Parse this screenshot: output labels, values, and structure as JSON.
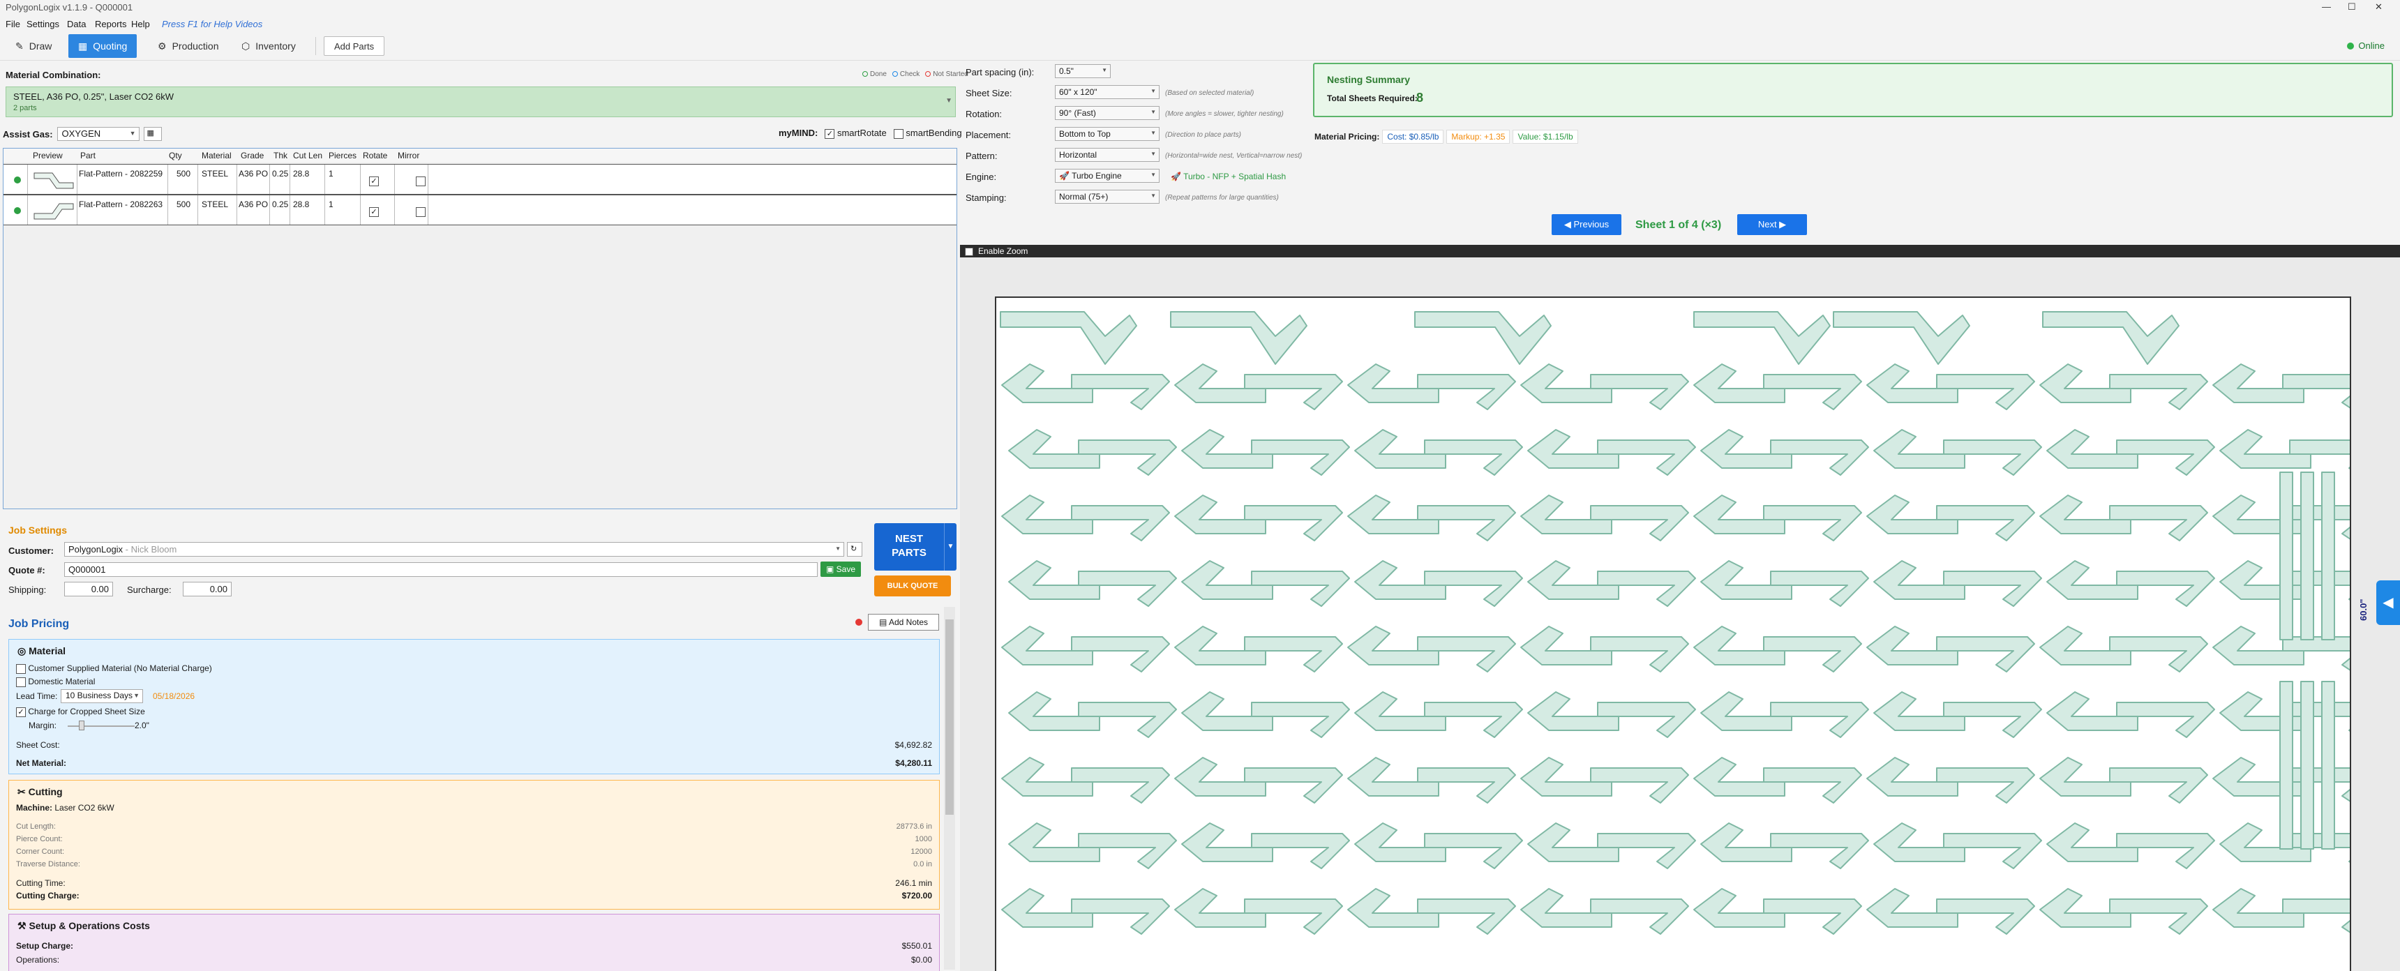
{
  "window": {
    "title": "PolygonLogix v1.1.9 - Q000001",
    "min": "—",
    "max": "☐",
    "close": "✕"
  },
  "menu": {
    "file": "File",
    "settings": "Settings",
    "data": "Data",
    "reports": "Reports",
    "help": "Help",
    "hint": "Press F1 for Help Videos"
  },
  "tabs": {
    "draw": "Draw",
    "quoting": "Quoting",
    "production": "Production",
    "inventory": "Inventory",
    "add_parts": "Add Parts"
  },
  "status": {
    "online": "Online"
  },
  "material": {
    "label": "Material Combination:",
    "legend": {
      "done": "Done",
      "check": "Check",
      "not_started": "Not Started"
    },
    "combo_title": "STEEL, A36 PO, 0.25\", Laser CO2 6kW",
    "combo_sub": "2 parts"
  },
  "assist": {
    "label": "Assist Gas:",
    "value": "OXYGEN"
  },
  "mymind": {
    "label": "myMIND:",
    "smart_rotate": "smartRotate",
    "smart_bending": "smartBending"
  },
  "parts": {
    "headers": {
      "preview": "Preview",
      "part": "Part",
      "qty": "Qty",
      "material": "Material",
      "grade": "Grade",
      "thk": "Thk",
      "cutlen": "Cut Len",
      "pierces": "Pierces",
      "rotate": "Rotate",
      "mirror": "Mirror"
    },
    "rows": [
      {
        "part": "Flat-Pattern - 2082259",
        "qty": "500",
        "material": "STEEL",
        "grade": "A36 PO",
        "thk": "0.25",
        "cutlen": "28.8",
        "pierces": "1",
        "rotate": "✓",
        "mirror": ""
      },
      {
        "part": "Flat-Pattern - 2082263",
        "qty": "500",
        "material": "STEEL",
        "grade": "A36 PO",
        "thk": "0.25",
        "cutlen": "28.8",
        "pierces": "1",
        "rotate": "✓",
        "mirror": ""
      }
    ]
  },
  "job": {
    "title": "Job Settings",
    "customer_label": "Customer:",
    "customer_value": "PolygonLogix",
    "customer_contact": " - Nick Bloom",
    "quote_label": "Quote #:",
    "quote_value": "Q000001",
    "save": "Save",
    "shipping_label": "Shipping:",
    "shipping_value": "0.00",
    "surcharge_label": "Surcharge:",
    "surcharge_value": "0.00",
    "nest_line1": "NEST",
    "nest_line2": "PARTS",
    "bulk_quote": "BULK QUOTE"
  },
  "pricing": {
    "title": "Job Pricing",
    "add_notes": "Add Notes",
    "material": {
      "title": "Material",
      "customer_supplied": "Customer Supplied Material (No Material Charge)",
      "domestic": "Domestic Material",
      "lead_time_label": "Lead Time:",
      "lead_time_value": "10 Business Days",
      "lead_date": "05/18/2026",
      "charge_cropped": "Charge for Cropped Sheet Size",
      "margin_label": "Margin:",
      "margin_value": "2.0\"",
      "sheet_cost_label": "Sheet Cost:",
      "sheet_cost_value": "$4,692.82",
      "net_material_label": "Net Material:",
      "net_material_value": "$4,280.11"
    },
    "cutting": {
      "title": "Cutting",
      "machine_label": "Machine:",
      "machine_value": "Laser CO2 6kW",
      "cut_length_label": "Cut Length:",
      "cut_length_value": "28773.6 in",
      "pierce_label": "Pierce Count:",
      "pierce_value": "1000",
      "corner_label": "Corner Count:",
      "corner_value": "12000",
      "traverse_label": "Traverse Distance:",
      "traverse_value": "0.0 in",
      "time_label": "Cutting Time:",
      "time_value": "246.1 min",
      "charge_label": "Cutting Charge:",
      "charge_value": "$720.00"
    },
    "setup": {
      "title": "Setup & Operations Costs",
      "setup_label": "Setup Charge:",
      "setup_value": "$550.01",
      "ops_label": "Operations:",
      "ops_value": "$0.00"
    }
  },
  "nest": {
    "spacing_label": "Part spacing (in):",
    "spacing_value": "0.5\"",
    "sheet_size_label": "Sheet Size:",
    "sheet_size_value": "60\" x 120\"",
    "sheet_size_hint": "(Based on selected material)",
    "rotation_label": "Rotation:",
    "rotation_value": "90° (Fast)",
    "rotation_hint": "(More angles = slower, tighter nesting)",
    "placement_label": "Placement:",
    "placement_value": "Bottom to Top",
    "placement_hint": "(Direction to place parts)",
    "pattern_label": "Pattern:",
    "pattern_value": "Horizontal",
    "pattern_hint": "(Horizontal=wide nest, Vertical=narrow nest)",
    "engine_label": "Engine:",
    "engine_value": "Turbo Engine",
    "engine_note": "Turbo - NFP + Spatial Hash",
    "stamping_label": "Stamping:",
    "stamping_value": "Normal (75+)",
    "stamping_hint": "(Repeat patterns for large quantities)"
  },
  "summary": {
    "title": "Nesting Summary",
    "total_label": "Total Sheets Required:",
    "total_value": "8",
    "mp_label": "Material Pricing:",
    "cost": "Cost: $0.85/lb",
    "markup": "Markup: +1.35",
    "value": "Value: $1.15/lb"
  },
  "nav": {
    "previous": "◀ Previous",
    "sheet_info": "Sheet 1 of 4 (×3)",
    "next": "Next ▶"
  },
  "zoom": {
    "label": "Enable Zoom"
  },
  "canvas": {
    "dim": "60.0\"",
    "side_tab": "◀"
  },
  "colors": {
    "accent": "#2d86e0",
    "part_fill": "#d5ebe3",
    "part_stroke": "#7fb8a4"
  }
}
